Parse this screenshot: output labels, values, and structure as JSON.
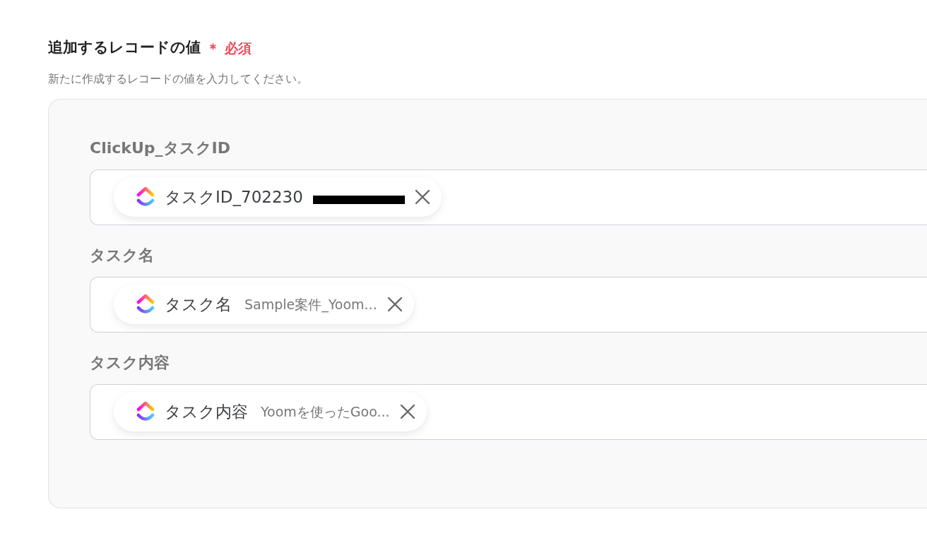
{
  "section": {
    "title": "追加するレコードの値",
    "required_mark": "＊",
    "required_label": "必須",
    "description": "新たに作成するレコードの値を入力してください。"
  },
  "fields": [
    {
      "label": "ClickUp_タスクID",
      "chip": {
        "name": "タスクID_702230",
        "redacted": true
      }
    },
    {
      "label": "タスク名",
      "chip": {
        "name": "タスク名",
        "value": "Sample案件_Yoom...",
        "redacted": false
      }
    },
    {
      "label": "タスク内容",
      "chip": {
        "name": "タスク内容",
        "value": "Yoomを使ったGoo...",
        "redacted": false
      }
    }
  ]
}
